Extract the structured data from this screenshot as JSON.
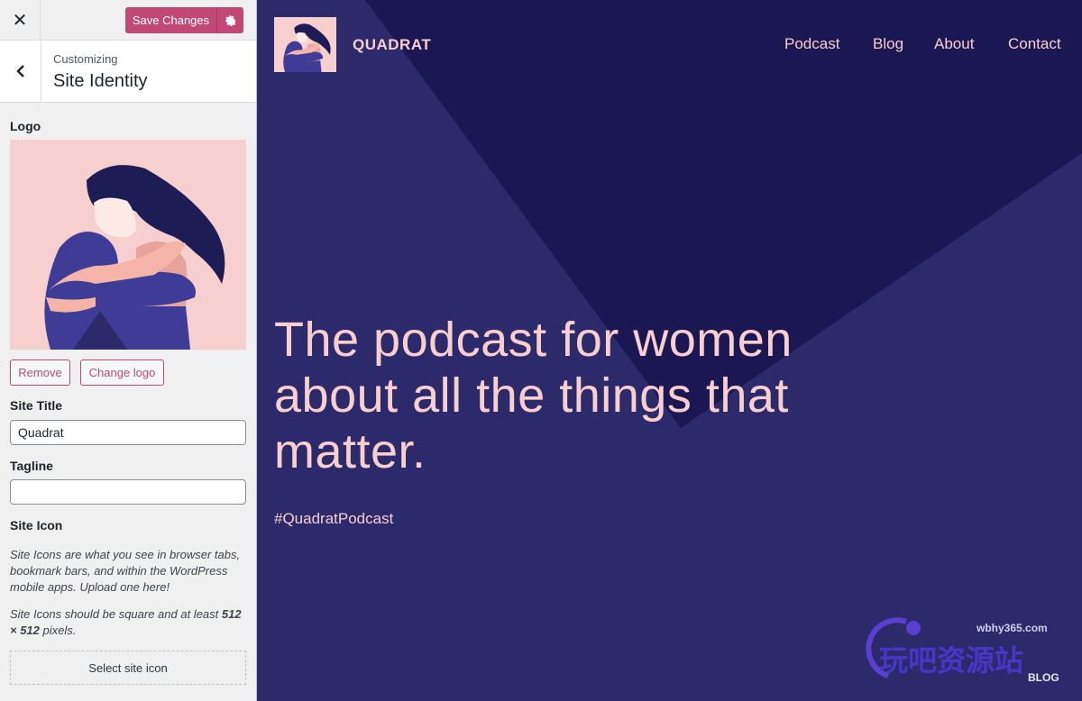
{
  "sidebar": {
    "close_icon": "close-icon",
    "save_label": "Save Changes",
    "gear_icon": "gear-icon",
    "back_icon": "chevron-left-icon",
    "breadcrumb": "Customizing",
    "section": "Site Identity",
    "logo_label": "Logo",
    "remove_label": "Remove",
    "change_logo_label": "Change logo",
    "site_title_label": "Site Title",
    "site_title_value": "Quadrat",
    "tagline_label": "Tagline",
    "tagline_value": "",
    "site_icon_label": "Site Icon",
    "site_icon_desc1": "Site Icons are what you see in browser tabs, bookmark bars, and within the WordPress mobile apps. Upload one here!",
    "site_icon_desc2_pre": "Site Icons should be square and at least ",
    "site_icon_desc2_bold": "512 × 512",
    "site_icon_desc2_post": " pixels.",
    "select_icon_label": "Select site icon",
    "accent": "#c04873"
  },
  "preview": {
    "site_title": "QUADRAT",
    "nav": [
      "Podcast",
      "Blog",
      "About",
      "Contact"
    ],
    "hero": "The podcast for women about all the things that matter.",
    "hashtag": "#QuadratPodcast",
    "background": "#2c2a6b",
    "text_color": "#f8cfcf"
  },
  "watermark": {
    "url": "wbhy365.com",
    "text": "玩吧资源站",
    "sub": "BLOG"
  }
}
